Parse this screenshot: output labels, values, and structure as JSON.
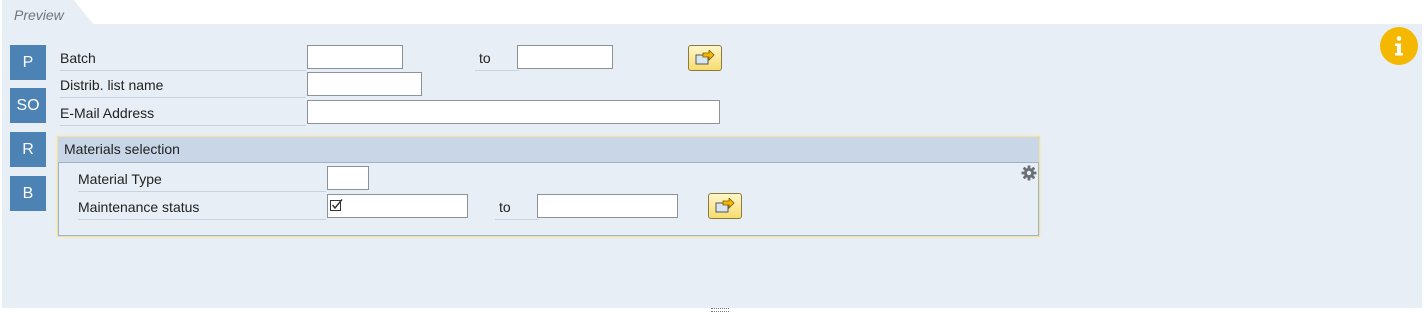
{
  "tab": {
    "label": "Preview"
  },
  "side_buttons": [
    "P",
    "SO",
    "R",
    "B"
  ],
  "fields": {
    "batch": {
      "label": "Batch",
      "from_value": "",
      "to_label": "to",
      "to_value": ""
    },
    "distrib_list": {
      "label": "Distrib. list name",
      "value": ""
    },
    "email": {
      "label": "E-Mail Address",
      "value": ""
    }
  },
  "materials": {
    "title": "Materials selection",
    "material_type": {
      "label": "Material Type",
      "value": ""
    },
    "maintenance_status": {
      "label": "Maintenance status",
      "from_value": "",
      "to_label": "to",
      "to_value": ""
    }
  },
  "icons": {
    "multiple_selection": "multiple-selection-arrow-icon",
    "settings": "gear-icon",
    "info": "info-icon",
    "checkbox": "checkbox-icon"
  },
  "colors": {
    "panel_bg": "#e8eef5",
    "side_button_bg": "#4c82b4",
    "info_bg": "#f5b800",
    "group_header_bg": "#c8d6e7"
  }
}
